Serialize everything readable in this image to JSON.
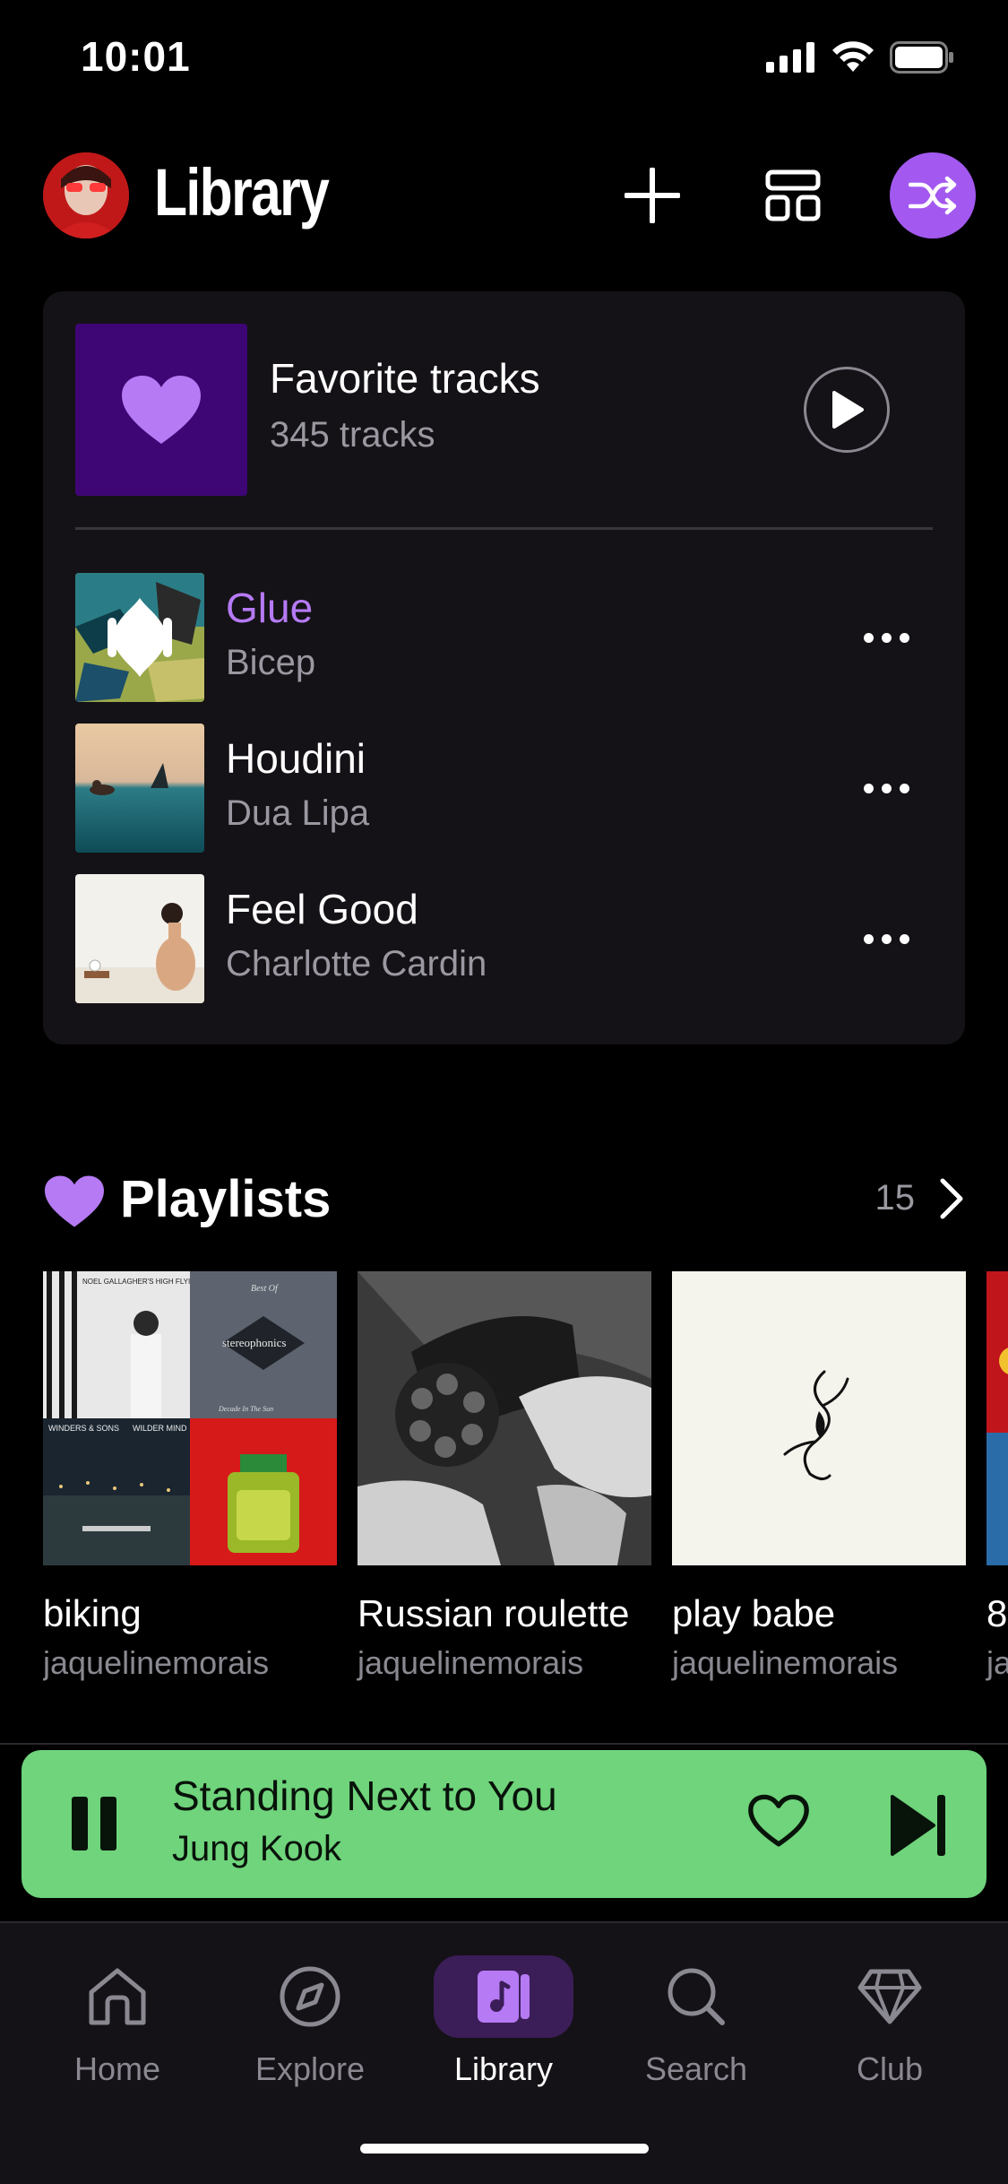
{
  "status_bar": {
    "time": "10:01",
    "signal_icon": "cellular-signal-icon",
    "wifi_icon": "wifi-icon",
    "battery_icon": "battery-icon"
  },
  "header": {
    "title": "Library",
    "avatar_icon": "user-avatar",
    "add_icon": "plus-icon",
    "layout_icon": "layout-grid-icon",
    "shuffle_icon": "shuffle-icon"
  },
  "favorites": {
    "title": "Favorite tracks",
    "count": "345 tracks",
    "cover_icon": "heart-icon",
    "play_icon": "play-icon",
    "tracks": [
      {
        "title": "Glue",
        "artist": "Bicep",
        "active": true
      },
      {
        "title": "Houdini",
        "artist": "Dua Lipa",
        "active": false
      },
      {
        "title": "Feel Good",
        "artist": "Charlotte Cardin",
        "active": false
      }
    ]
  },
  "playlists": {
    "title": "Playlists",
    "count": "15",
    "items": [
      {
        "name": "biking",
        "owner": "jaquelinemorais"
      },
      {
        "name": "Russian roulette",
        "owner": "jaquelinemorais"
      },
      {
        "name": "play babe",
        "owner": "jaquelinemorais"
      },
      {
        "name": "8",
        "owner": "ja"
      }
    ],
    "biking_cover_texts": [
      "NOEL GALLAGHER'S HIGH FLYING BIRDS",
      "Best Of",
      "stereophonics",
      "Decade In The Sun",
      "WINDERS & SONS",
      "WILDER MIND"
    ]
  },
  "now_playing": {
    "title": "Standing Next to You",
    "artist": "Jung Kook",
    "pause_icon": "pause-icon",
    "like_icon": "heart-outline-icon",
    "next_icon": "skip-next-icon"
  },
  "tabs": [
    {
      "label": "Home",
      "icon": "home-icon",
      "active": false
    },
    {
      "label": "Explore",
      "icon": "compass-icon",
      "active": false
    },
    {
      "label": "Library",
      "icon": "library-icon",
      "active": true
    },
    {
      "label": "Search",
      "icon": "search-icon",
      "active": false
    },
    {
      "label": "Club",
      "icon": "diamond-icon",
      "active": false
    }
  ],
  "colors": {
    "background": "#000000",
    "card": "#141216",
    "accent_purple": "#a359f0",
    "active_track": "#b67af5",
    "mini_player": "#6fd47b",
    "secondary_text": "#9a98a0"
  }
}
